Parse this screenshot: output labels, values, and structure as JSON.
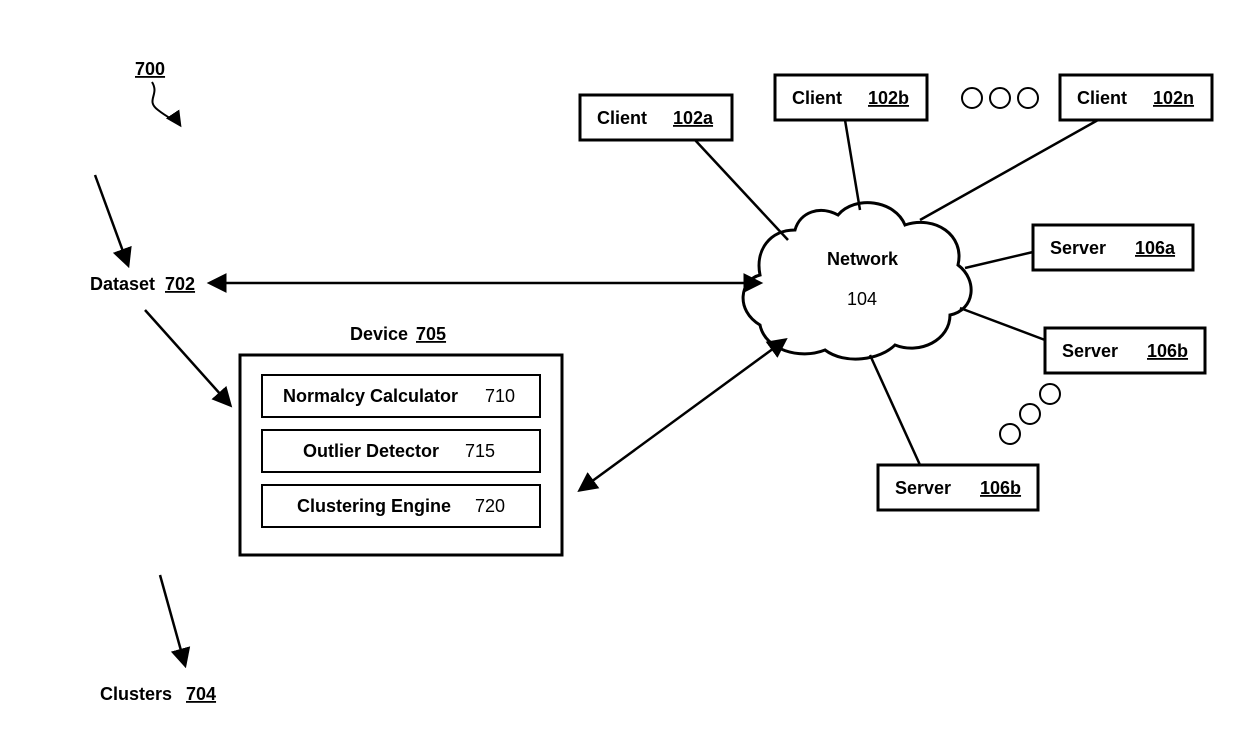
{
  "figure_ref": "700",
  "dataset": {
    "label": "Dataset",
    "ref": "702"
  },
  "clusters": {
    "label": "Clusters",
    "ref": "704"
  },
  "device": {
    "label": "Device",
    "ref": "705",
    "components": [
      {
        "label": "Normalcy Calculator",
        "ref": "710"
      },
      {
        "label": "Outlier Detector",
        "ref": "715"
      },
      {
        "label": "Clustering Engine",
        "ref": "720"
      }
    ]
  },
  "network": {
    "label": "Network",
    "ref": "104"
  },
  "clients": [
    {
      "label": "Client",
      "ref": "102a"
    },
    {
      "label": "Client",
      "ref": "102b"
    },
    {
      "label": "Client",
      "ref": "102n"
    }
  ],
  "servers": [
    {
      "label": "Server",
      "ref": "106a"
    },
    {
      "label": "Server",
      "ref": "106b"
    },
    {
      "label": "Server",
      "ref": "106b"
    }
  ]
}
